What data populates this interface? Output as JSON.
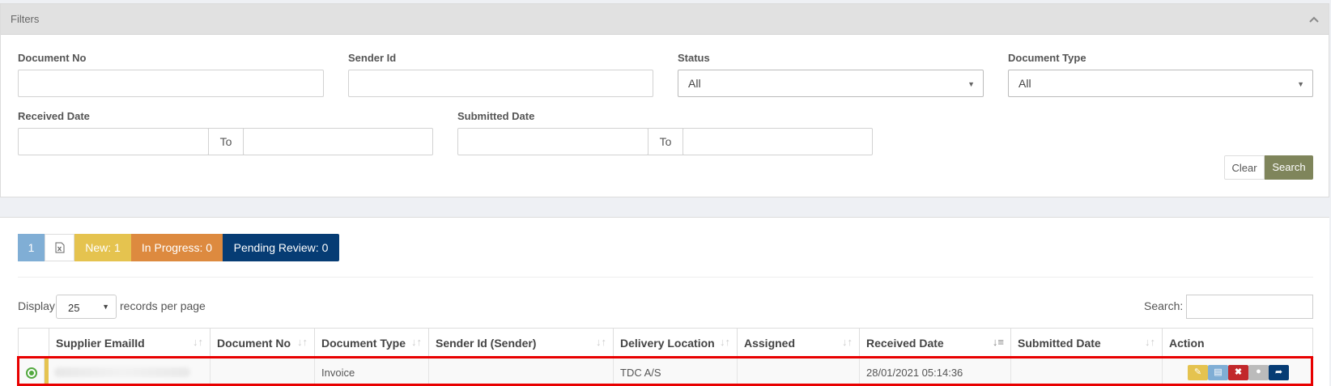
{
  "filters": {
    "title": "Filters",
    "document_no_label": "Document No",
    "sender_id_label": "Sender Id",
    "status_label": "Status",
    "status_value": "All",
    "document_type_label": "Document Type",
    "document_type_value": "All",
    "received_date_label": "Received Date",
    "submitted_date_label": "Submitted Date",
    "to_label": "To",
    "clear_label": "Clear",
    "search_label": "Search"
  },
  "toolbar": {
    "page": "1",
    "new": "New: 1",
    "in_progress": "In Progress: 0",
    "pending_review": "Pending Review: 0"
  },
  "table_controls": {
    "display_label": "Display",
    "page_length": "25",
    "records_label": "records per page",
    "search_label": "Search:"
  },
  "table": {
    "columns": [
      "Supplier EmailId",
      "Document No",
      "Document Type",
      "Sender Id (Sender)",
      "Delivery Location",
      "Assigned",
      "Received Date",
      "Submitted Date",
      "Action"
    ],
    "rows": [
      {
        "supplier_email": "",
        "document_no": "",
        "document_type": "Invoice",
        "sender_id": "",
        "delivery_location": "TDC A/S",
        "assigned": "",
        "received_date": "28/01/2021 05:14:36",
        "submitted_date": ""
      }
    ]
  },
  "colors": {
    "new": "#e5c34f",
    "in_progress": "#dd8a3f",
    "pending_review": "#063c74",
    "search_button": "#7f855b",
    "highlight": "#e80000"
  },
  "icons": [
    "chevron-up-icon",
    "excel-icon",
    "sort-icon",
    "expand-icon",
    "edit-icon",
    "pdf-icon",
    "delete-icon",
    "comment-icon",
    "forward-icon"
  ]
}
